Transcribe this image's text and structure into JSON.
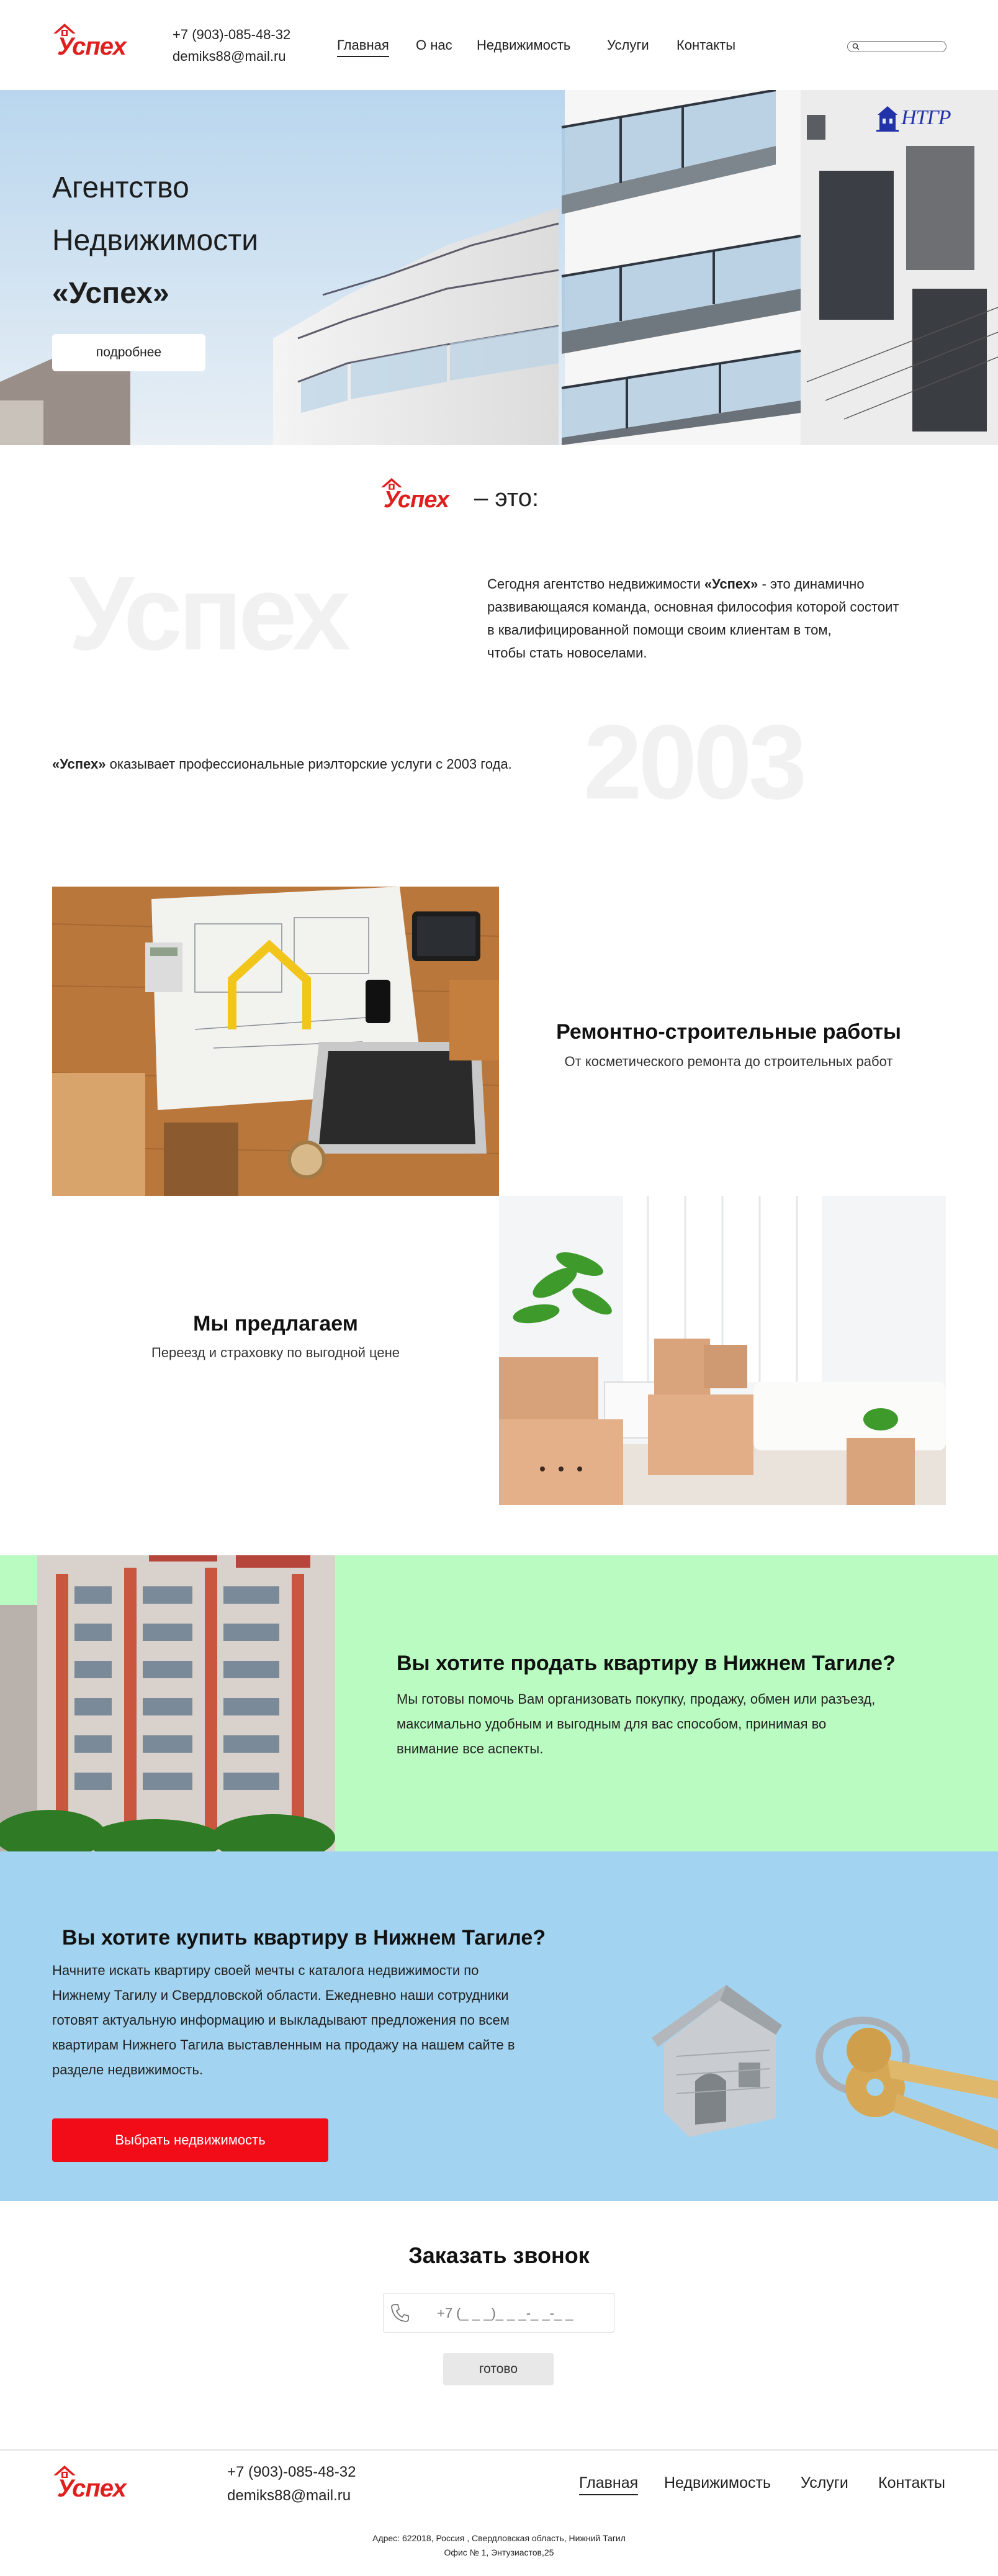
{
  "header": {
    "logo_text": "Успех",
    "phone": "+7 (903)-085-48-32",
    "email": "demiks88@mail.ru",
    "nav": [
      {
        "label": "Главная",
        "active": true
      },
      {
        "label": "О нас",
        "active": false
      },
      {
        "label": "Недвижимость",
        "active": false
      },
      {
        "label": "Услуги",
        "active": false
      },
      {
        "label": "Контакты",
        "active": false
      }
    ],
    "search_icon": "search-icon",
    "search_placeholder": ""
  },
  "hero": {
    "title_line1": "Агентство",
    "title_line2": "Недвижимости",
    "title_line3": "«Успех»",
    "button_label": "подробнее",
    "partner_logo_text": "НТГР"
  },
  "about": {
    "logo_text": "Успех",
    "heading_suffix": "– это:",
    "watermark_word": "Успех",
    "watermark_year": "2003",
    "paragraph_brand": "«Успех»",
    "paragraph_prefix": "Сегодня агентство недвижимости ",
    "paragraph_rest_1": " - это динамично",
    "paragraph_line2": "развивающаяся команда, основная философия которой состоит",
    "paragraph_line3": "в квалифицированной помощи своим клиентам в том,",
    "paragraph_line4": "чтобы стать новоселами.",
    "since_brand": "«Успех»",
    "since_text": " оказывает профессиональные риэлторские услуги с 2003 года."
  },
  "services": {
    "repair_title": "Ремонтно-строительные работы",
    "repair_sub": "От косметического ремонта до строительных работ",
    "offer_title": "Мы предлагаем",
    "offer_sub": "Переезд и страховку по выгодной цене"
  },
  "sell": {
    "title": "Вы хотите продать квартиру в Нижнем Тагиле?",
    "line1": "Мы готовы помочь Вам организовать покупку, продажу, обмен или разъезд,",
    "line2": "максимально удобным и выгодным для вас способом, принимая во",
    "line3": "внимание все аспекты."
  },
  "buy": {
    "title": "Вы хотите купить квартиру в Нижнем Тагиле?",
    "line1": "Начните искать квартиру своей мечты с каталога недвижимости по",
    "line2": "Нижнему Тагилу и Свердловской области. Ежедневно наши сотрудники",
    "line3": "готовят актуальную информацию и выкладывают предложения по всем",
    "line4": "квартирам Нижнего Тагила выставленным на продажу на нашем сайте в",
    "line5": "разделе недвижимость.",
    "button_label": "Выбрать недвижимость"
  },
  "callback": {
    "title": "Заказать звонок",
    "phone_icon": "phone-icon",
    "phone_placeholder": "+7 (_ _ _)_ _ _-_ _-_ _",
    "button_label": "готово"
  },
  "footer": {
    "logo_text": "Успех",
    "phone": "+7 (903)-085-48-32",
    "email": "demiks88@mail.ru",
    "nav": [
      {
        "label": "Главная",
        "active": true
      },
      {
        "label": "Недвижимость",
        "active": false
      },
      {
        "label": "Услуги",
        "active": false
      },
      {
        "label": "Контакты",
        "active": false
      }
    ],
    "address_line1": "Адрес: 622018, Россия , Свердловская область, Нижний Тагил",
    "address_line2": "Офис № 1, Энтузиастов,25"
  },
  "colors": {
    "brand_red": "#e01e1e",
    "sell_band": "#b9fbc1",
    "buy_band": "#a2d4f1",
    "button_red": "#f10c17"
  }
}
